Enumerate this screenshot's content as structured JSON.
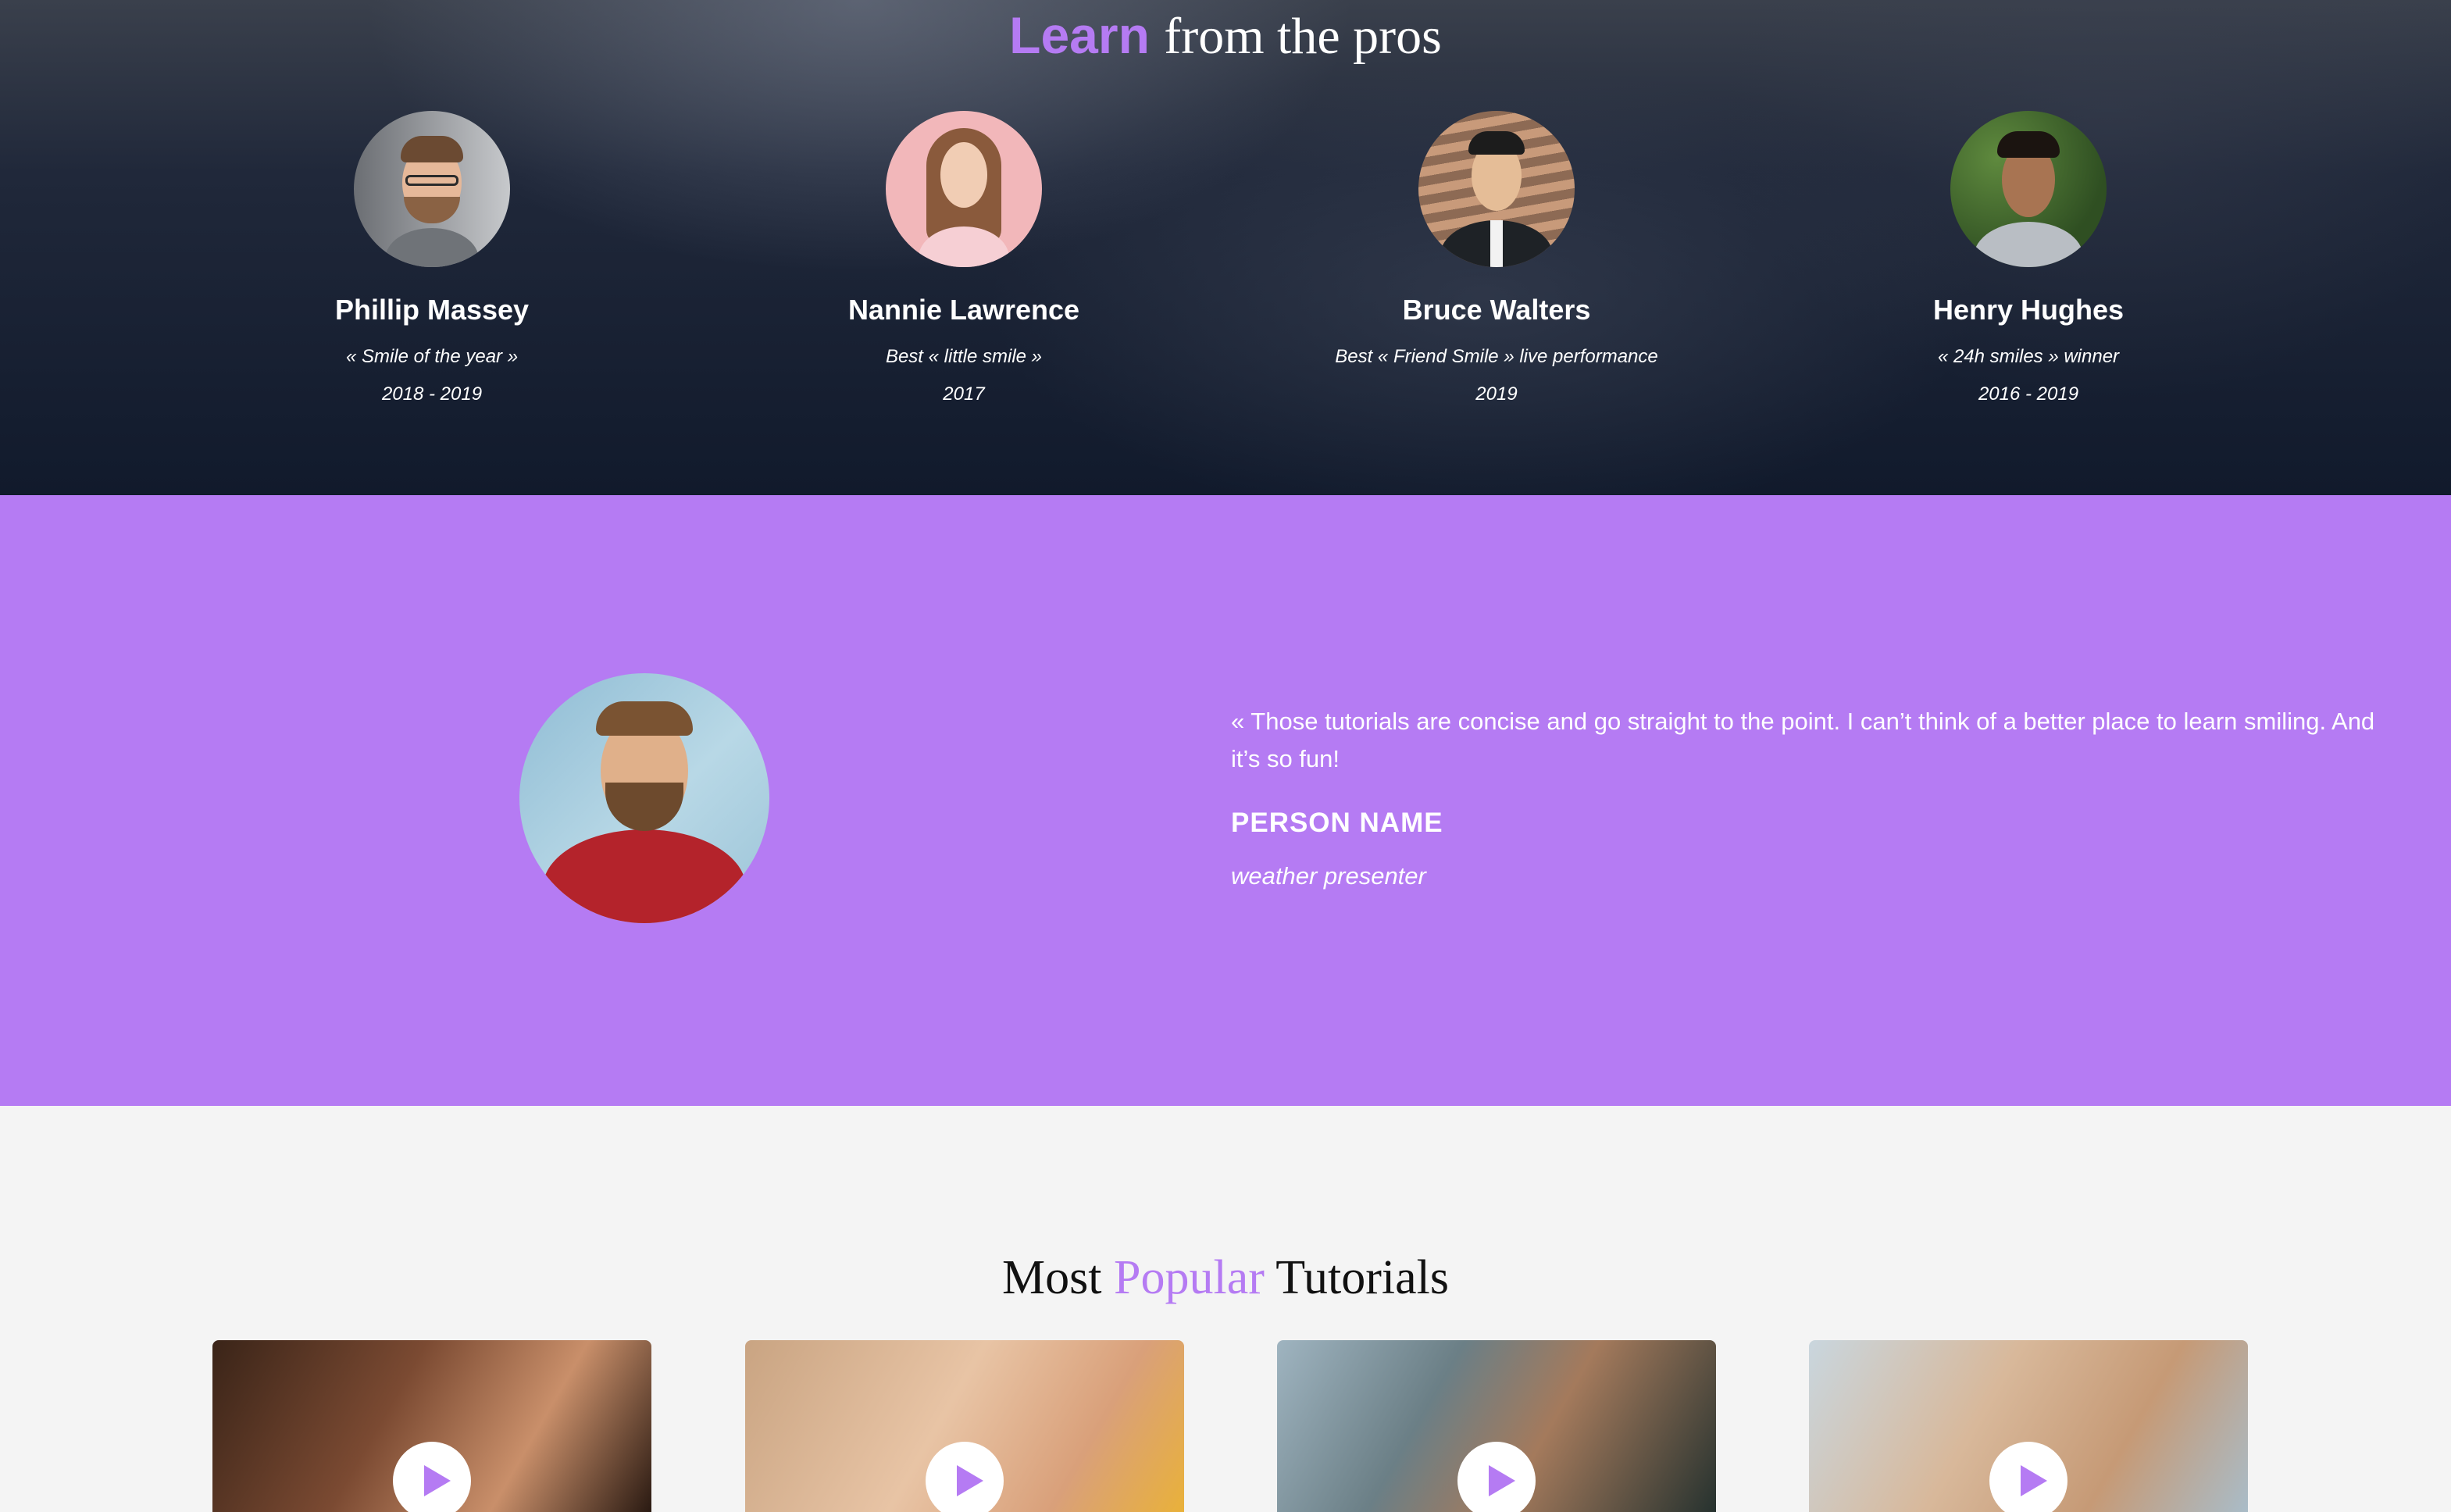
{
  "pros": {
    "title_accent": "Learn",
    "title_rest": "from the pros",
    "people": [
      {
        "name": "Phillip Massey",
        "award": "« Smile of the year »",
        "years": "2018 - 2019"
      },
      {
        "name": "Nannie Lawrence",
        "award": "Best « little smile »",
        "years": "2017"
      },
      {
        "name": "Bruce Walters",
        "award": "Best « Friend Smile » live performance",
        "years": "2019"
      },
      {
        "name": "Henry Hughes",
        "award": "« 24h smiles » winner",
        "years": "2016 - 2019"
      }
    ]
  },
  "testimonial": {
    "quote": "« Those tutorials are concise and go straight to the point. I can’t think of a better place to learn smiling. And it’s so fun!",
    "name": "PERSON NAME",
    "role": "weather presenter"
  },
  "tutorials": {
    "title_before": "Most",
    "title_accent": "Popular",
    "title_after": "Tutorials",
    "cards": [
      {
        "icon": "play-icon"
      },
      {
        "icon": "play-icon"
      },
      {
        "icon": "play-icon"
      },
      {
        "icon": "play-icon"
      }
    ]
  },
  "colors": {
    "accent": "#b57bf3",
    "dark_bg": "#111a2c",
    "light_bg": "#f4f4f4"
  }
}
